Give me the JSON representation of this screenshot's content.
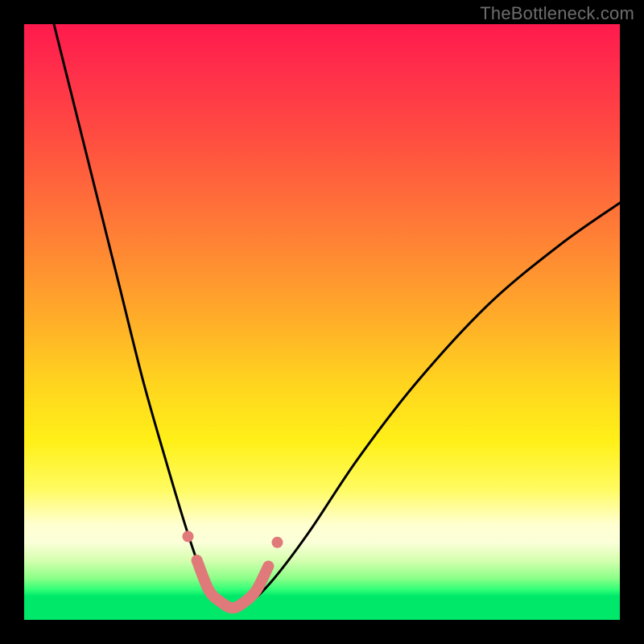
{
  "watermark": "TheBottleneck.com",
  "colors": {
    "frame": "#000000",
    "gradient_top": "#ff1a4d",
    "gradient_mid": "#ffd31f",
    "gradient_bottom": "#00e86a",
    "curve": "#000000",
    "marker": "#e07a7a"
  },
  "chart_data": {
    "type": "line",
    "title": "",
    "xlabel": "",
    "ylabel": "",
    "xlim": [
      0,
      100
    ],
    "ylim": [
      0,
      100
    ],
    "grid": false,
    "legend": false,
    "series": [
      {
        "name": "bottleneck-curve",
        "x": [
          5,
          8,
          12,
          16,
          20,
          24,
          27,
          29,
          31,
          33,
          35,
          38,
          42,
          48,
          56,
          66,
          78,
          90,
          100
        ],
        "y": [
          100,
          88,
          72,
          56,
          40,
          26,
          16,
          10,
          5,
          3,
          2,
          3,
          7,
          15,
          27,
          40,
          53,
          63,
          70
        ]
      }
    ],
    "markers": {
      "name": "highlight-segment",
      "x": [
        29,
        31,
        33,
        35,
        37,
        39,
        41
      ],
      "y": [
        10,
        5,
        3,
        2,
        3,
        5,
        9
      ]
    }
  }
}
